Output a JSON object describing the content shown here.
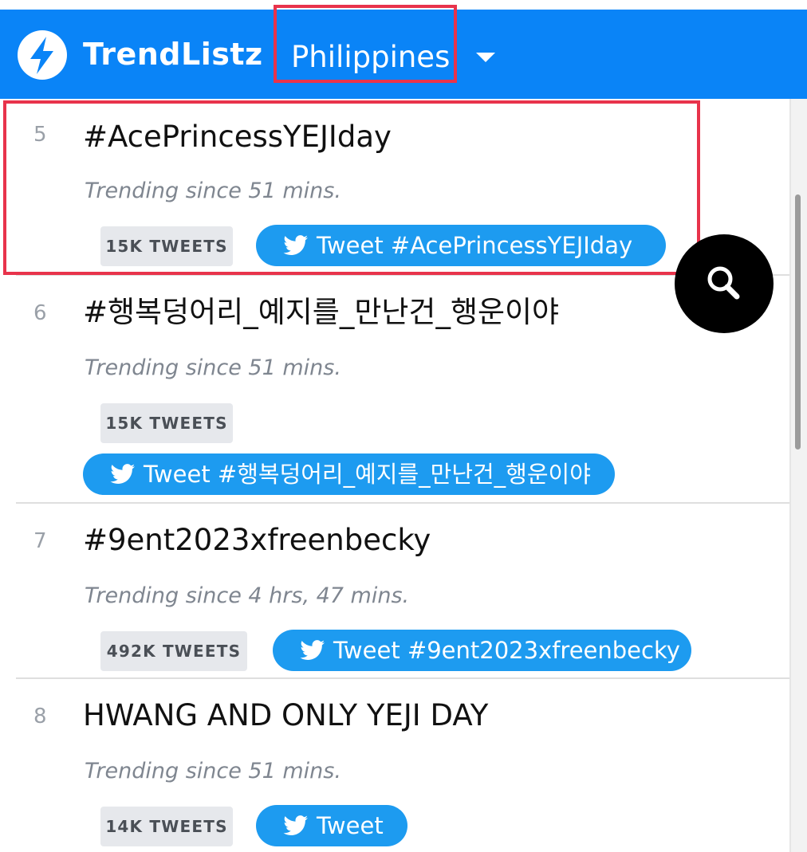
{
  "header": {
    "brand": "TrendListz",
    "country": "Philippines",
    "brand_color": "#0a84f7"
  },
  "icons": {
    "logo": "lightning-bolt-icon",
    "dropdown": "caret-down-icon",
    "search": "search-icon",
    "twitter": "twitter-bird-icon"
  },
  "trends": [
    {
      "rank": "5",
      "title": "#AcePrincessYEJIday",
      "since": "Trending since 51 mins.",
      "count": "15K TWEETS",
      "tweet_label": "Tweet #AcePrincessYEJIday"
    },
    {
      "rank": "6",
      "title": "#행복덩어리_예지를_만난건_행운이야",
      "since": "Trending since 51 mins.",
      "count": "15K TWEETS",
      "tweet_label": "Tweet #행복덩어리_예지를_만난건_행운이야"
    },
    {
      "rank": "7",
      "title": "#9ent2023xfreenbecky",
      "since": "Trending since 4 hrs, 47 mins.",
      "count": "492K TWEETS",
      "tweet_label": "Tweet #9ent2023xfreenbecky"
    },
    {
      "rank": "8",
      "title": "HWANG AND ONLY YEJI DAY",
      "since": "Trending since 51 mins.",
      "count": "14K TWEETS",
      "tweet_label": "Tweet"
    }
  ],
  "colors": {
    "highlight": "#e8334b",
    "tweet_button": "#1d9bf0",
    "count_badge": "#e6e8ec"
  }
}
